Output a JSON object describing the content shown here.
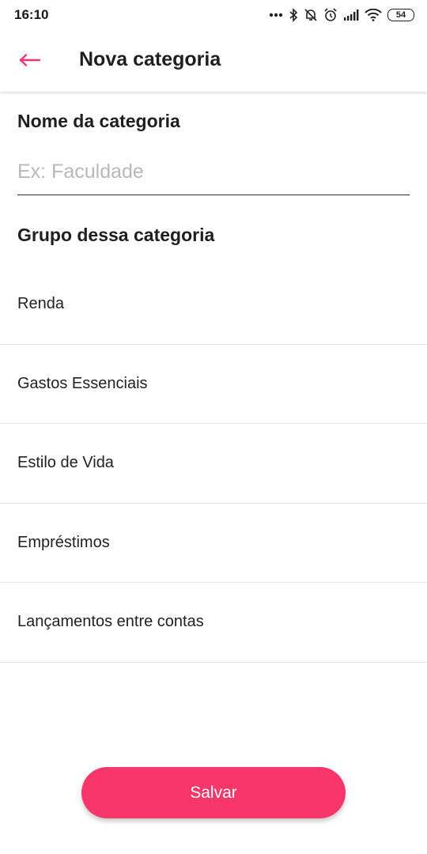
{
  "status_bar": {
    "time": "16:10",
    "battery": "54",
    "icons": [
      "more-dots-icon",
      "bluetooth-icon",
      "muted-bell-icon",
      "alarm-icon",
      "signal-icon",
      "wifi-icon",
      "battery-icon"
    ]
  },
  "header": {
    "back_icon": "arrow-left-icon",
    "title": "Nova categoria"
  },
  "form": {
    "name_label": "Nome da categoria",
    "name_placeholder": "Ex: Faculdade",
    "name_value": "",
    "group_label": "Grupo dessa categoria",
    "groups": [
      {
        "label": "Renda"
      },
      {
        "label": "Gastos Essenciais"
      },
      {
        "label": "Estilo de Vida"
      },
      {
        "label": "Empréstimos"
      },
      {
        "label": "Lançamentos entre contas"
      }
    ]
  },
  "actions": {
    "save_label": "Salvar"
  },
  "colors": {
    "accent": "#f7366a",
    "text": "#222222",
    "placeholder": "#b9b9b9",
    "divider": "#e6e6e6"
  }
}
